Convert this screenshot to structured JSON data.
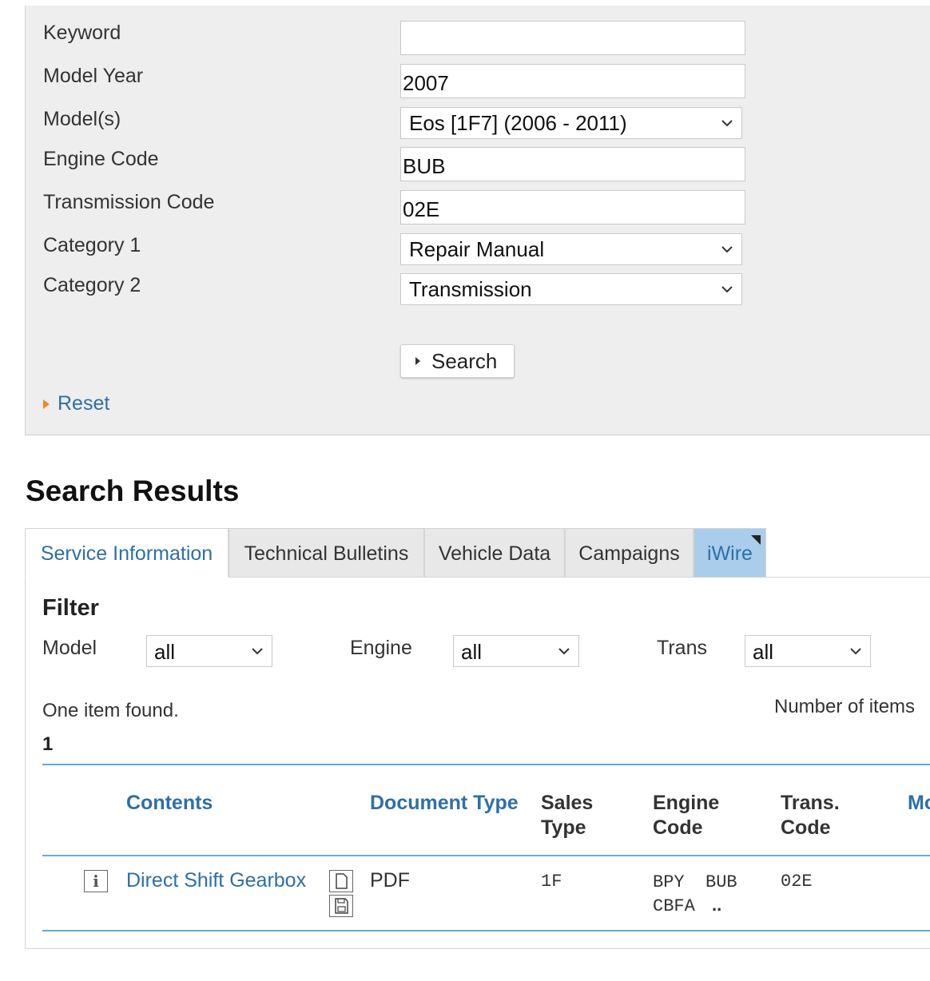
{
  "search_form": {
    "keyword_label": "Keyword",
    "keyword_value": "",
    "model_year_label": "Model Year",
    "model_year_value": "2007",
    "models_label": "Model(s)",
    "models_value": "Eos [1F7] (2006 - 2011)",
    "engine_code_label": "Engine Code",
    "engine_code_value": "BUB",
    "transmission_code_label": "Transmission Code",
    "transmission_code_value": "02E",
    "category1_label": "Category 1",
    "category1_value": "Repair Manual",
    "category2_label": "Category 2",
    "category2_value": "Transmission",
    "search_button": "Search",
    "reset_link": "Reset"
  },
  "results": {
    "title": "Search Results",
    "tabs": [
      {
        "label": "Service Information",
        "active": true
      },
      {
        "label": "Technical Bulletins",
        "active": false
      },
      {
        "label": "Vehicle Data",
        "active": false
      },
      {
        "label": "Campaigns",
        "active": false
      },
      {
        "label": "iWire",
        "active": false
      }
    ],
    "filter": {
      "title": "Filter",
      "model_label": "Model",
      "model_value": "all",
      "engine_label": "Engine",
      "engine_value": "all",
      "trans_label": "Trans",
      "trans_value": "all"
    },
    "found_text": "One item found.",
    "number_of_items_label": "Number of items",
    "page": "1",
    "columns": {
      "contents": "Contents",
      "document_type": "Document Type",
      "sales_type_1": "Sales",
      "sales_type_2": "Type",
      "engine_code_1": "Engine",
      "engine_code_2": "Code",
      "trans_code_1": "Trans.",
      "trans_code_2": "Code",
      "more": "Mo"
    },
    "rows": [
      {
        "contents": "Direct Shift Gearbox",
        "document_type": "PDF",
        "sales_type": "1F",
        "engine_codes_line1": "BPY  BUB",
        "engine_codes_line2": "CBFA",
        "engine_more": "..",
        "trans_code": "02E"
      }
    ]
  },
  "colors": {
    "panel_bg": "#eeeeee",
    "link": "#2e6fa7",
    "accent_orange": "#f08a2a",
    "rule_blue": "#6aa9d6",
    "iwire_tab": "#a9cdea"
  },
  "icons": [
    "chevron-down-icon",
    "triangle-right-icon",
    "info-icon",
    "document-icon",
    "save-icon",
    "corner-arrow-icon"
  ]
}
